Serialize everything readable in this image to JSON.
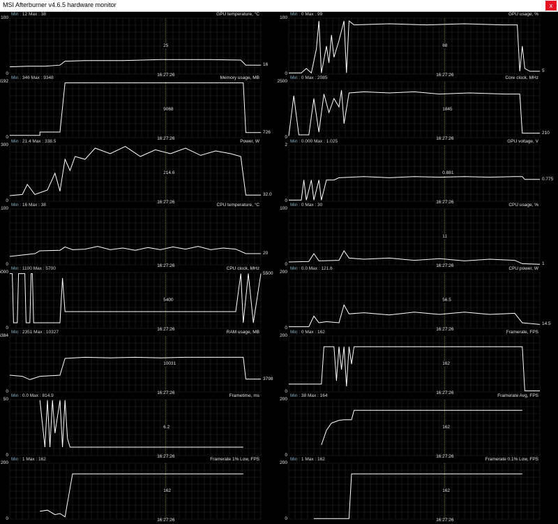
{
  "window": {
    "title": "MSI Afterburner v4.6.5 hardware monitor",
    "close_glyph": "x"
  },
  "colors": {
    "background": "#000000",
    "grid": "#2a2a2a",
    "line": "#ffffff",
    "marker": "#9a9a40",
    "min_label": "#8ab4c8"
  },
  "time_label": "16:27:26",
  "labels": {
    "min": "Min",
    "max": "Max"
  },
  "graphs": [
    {
      "id": "gpu-temp",
      "col": 0,
      "row": 0,
      "title": "GPU temperature, °C",
      "min": "12",
      "max": "38",
      "y_top": "100",
      "y_bottom": "0",
      "current": "16",
      "mid_value": "25",
      "trace": [
        [
          0,
          0.13
        ],
        [
          0.07,
          0.14
        ],
        [
          0.14,
          0.14
        ],
        [
          0.2,
          0.16
        ],
        [
          0.22,
          0.23
        ],
        [
          0.3,
          0.24
        ],
        [
          0.45,
          0.24
        ],
        [
          0.6,
          0.26
        ],
        [
          0.8,
          0.26
        ],
        [
          0.92,
          0.25
        ],
        [
          0.94,
          0.16
        ],
        [
          1,
          0.16
        ]
      ]
    },
    {
      "id": "gpu-usage",
      "col": 1,
      "row": 0,
      "title": "GPU usage, %",
      "min": "0",
      "max": "99",
      "y_top": "100",
      "y_bottom": "0",
      "current": "5",
      "mid_value": "88",
      "trace": [
        [
          0,
          0.02
        ],
        [
          0.05,
          0.02
        ],
        [
          0.07,
          0.1
        ],
        [
          0.09,
          0.02
        ],
        [
          0.11,
          0.45
        ],
        [
          0.12,
          0.95
        ],
        [
          0.13,
          0.02
        ],
        [
          0.15,
          0.5
        ],
        [
          0.16,
          0.2
        ],
        [
          0.17,
          0.7
        ],
        [
          0.18,
          0.3
        ],
        [
          0.2,
          0.6
        ],
        [
          0.22,
          0.95
        ],
        [
          0.23,
          0.02
        ],
        [
          0.24,
          0.95
        ],
        [
          0.26,
          0.88
        ],
        [
          0.4,
          0.9
        ],
        [
          0.55,
          0.88
        ],
        [
          0.7,
          0.9
        ],
        [
          0.85,
          0.88
        ],
        [
          0.91,
          0.88
        ],
        [
          0.92,
          0.05
        ],
        [
          0.93,
          0.5
        ],
        [
          0.94,
          0.1
        ],
        [
          0.96,
          0.05
        ],
        [
          1,
          0.05
        ]
      ]
    },
    {
      "id": "mem-usage",
      "col": 0,
      "row": 1,
      "title": "Memory usage, MB",
      "min": "346",
      "max": "9348",
      "y_top": "8192",
      "y_bottom": "0",
      "current": "726",
      "mid_value": "9068",
      "trace": [
        [
          0,
          0.04
        ],
        [
          0.12,
          0.04
        ],
        [
          0.12,
          0.1
        ],
        [
          0.2,
          0.1
        ],
        [
          0.22,
          0.98
        ],
        [
          0.93,
          0.98
        ],
        [
          0.94,
          0.09
        ],
        [
          1,
          0.09
        ]
      ]
    },
    {
      "id": "core-clock",
      "col": 1,
      "row": 1,
      "title": "Core clock, MHz",
      "min": "0",
      "max": "2085",
      "y_top": "2500",
      "y_bottom": "0",
      "current": "210",
      "mid_value": "1845",
      "trace": [
        [
          0,
          0.03
        ],
        [
          0.02,
          0.75
        ],
        [
          0.04,
          0.05
        ],
        [
          0.08,
          0.05
        ],
        [
          0.1,
          0.7
        ],
        [
          0.12,
          0.1
        ],
        [
          0.14,
          0.78
        ],
        [
          0.16,
          0.45
        ],
        [
          0.18,
          0.7
        ],
        [
          0.2,
          0.55
        ],
        [
          0.21,
          0.85
        ],
        [
          0.22,
          0.25
        ],
        [
          0.24,
          0.8
        ],
        [
          0.3,
          0.82
        ],
        [
          0.4,
          0.8
        ],
        [
          0.5,
          0.82
        ],
        [
          0.6,
          0.78
        ],
        [
          0.72,
          0.8
        ],
        [
          0.86,
          0.78
        ],
        [
          0.92,
          0.78
        ],
        [
          0.93,
          0.08
        ],
        [
          1,
          0.08
        ]
      ]
    },
    {
      "id": "power",
      "col": 0,
      "row": 2,
      "title": "Power, W",
      "min": "21.4",
      "max": "338.5",
      "y_top": "300",
      "y_bottom": "0",
      "current": "32.0",
      "mid_value": "214.6",
      "trace": [
        [
          0,
          0.1
        ],
        [
          0.05,
          0.12
        ],
        [
          0.07,
          0.3
        ],
        [
          0.1,
          0.12
        ],
        [
          0.15,
          0.2
        ],
        [
          0.18,
          0.5
        ],
        [
          0.2,
          0.18
        ],
        [
          0.22,
          0.75
        ],
        [
          0.24,
          0.55
        ],
        [
          0.26,
          0.8
        ],
        [
          0.3,
          0.75
        ],
        [
          0.34,
          0.95
        ],
        [
          0.4,
          0.85
        ],
        [
          0.46,
          0.98
        ],
        [
          0.52,
          0.8
        ],
        [
          0.58,
          0.92
        ],
        [
          0.64,
          0.85
        ],
        [
          0.7,
          0.95
        ],
        [
          0.76,
          0.82
        ],
        [
          0.82,
          0.9
        ],
        [
          0.88,
          0.85
        ],
        [
          0.92,
          0.8
        ],
        [
          0.94,
          0.11
        ],
        [
          1,
          0.11
        ]
      ]
    },
    {
      "id": "gpu-voltage",
      "col": 1,
      "row": 2,
      "title": "GPU voltage, V",
      "min": "0.000",
      "max": "1.025",
      "y_top": "2",
      "y_bottom": "0",
      "current": "0.775",
      "mid_value": "0.881",
      "trace": [
        [
          0,
          0.02
        ],
        [
          0.05,
          0.02
        ],
        [
          0.06,
          0.38
        ],
        [
          0.07,
          0.02
        ],
        [
          0.09,
          0.38
        ],
        [
          0.1,
          0.02
        ],
        [
          0.12,
          0.38
        ],
        [
          0.13,
          0.02
        ],
        [
          0.15,
          0.38
        ],
        [
          0.18,
          0.38
        ],
        [
          0.2,
          0.42
        ],
        [
          0.3,
          0.44
        ],
        [
          0.4,
          0.42
        ],
        [
          0.5,
          0.44
        ],
        [
          0.6,
          0.43
        ],
        [
          0.7,
          0.44
        ],
        [
          0.8,
          0.43
        ],
        [
          0.9,
          0.44
        ],
        [
          0.93,
          0.44
        ],
        [
          0.94,
          0.39
        ],
        [
          1,
          0.39
        ]
      ]
    },
    {
      "id": "cpu-temp",
      "col": 0,
      "row": 3,
      "title": "CPU temperature, °C",
      "min": "16",
      "max": "38",
      "y_top": "100",
      "y_bottom": "0",
      "current": "20",
      "mid_value": "",
      "trace": [
        [
          0,
          0.15
        ],
        [
          0.1,
          0.2
        ],
        [
          0.12,
          0.25
        ],
        [
          0.2,
          0.26
        ],
        [
          0.22,
          0.32
        ],
        [
          0.25,
          0.27
        ],
        [
          0.3,
          0.28
        ],
        [
          0.35,
          0.33
        ],
        [
          0.4,
          0.27
        ],
        [
          0.45,
          0.3
        ],
        [
          0.5,
          0.26
        ],
        [
          0.55,
          0.31
        ],
        [
          0.6,
          0.27
        ],
        [
          0.65,
          0.32
        ],
        [
          0.7,
          0.28
        ],
        [
          0.75,
          0.33
        ],
        [
          0.8,
          0.27
        ],
        [
          0.85,
          0.3
        ],
        [
          0.9,
          0.28
        ],
        [
          0.94,
          0.2
        ],
        [
          1,
          0.2
        ]
      ]
    },
    {
      "id": "cpu-usage",
      "col": 1,
      "row": 3,
      "title": "CPU usage, %",
      "min": "0",
      "max": "30",
      "y_top": "100",
      "y_bottom": "0",
      "current": "1",
      "mid_value": "11",
      "trace": [
        [
          0,
          0.05
        ],
        [
          0.08,
          0.06
        ],
        [
          0.1,
          0.2
        ],
        [
          0.12,
          0.07
        ],
        [
          0.2,
          0.08
        ],
        [
          0.22,
          0.25
        ],
        [
          0.24,
          0.12
        ],
        [
          0.3,
          0.1
        ],
        [
          0.4,
          0.12
        ],
        [
          0.5,
          0.08
        ],
        [
          0.6,
          0.11
        ],
        [
          0.7,
          0.07
        ],
        [
          0.8,
          0.1
        ],
        [
          0.9,
          0.08
        ],
        [
          0.93,
          0.02
        ],
        [
          1,
          0.01
        ]
      ]
    },
    {
      "id": "cpu-clock",
      "col": 0,
      "row": 4,
      "title": "CPU clock, MHz",
      "min": "1100",
      "max": "5700",
      "y_top": "5000",
      "y_bottom": "0",
      "current": "5500",
      "mid_value": "5400",
      "trace": [
        [
          0,
          0.98
        ],
        [
          0.01,
          0.98
        ],
        [
          0.015,
          0.1
        ],
        [
          0.03,
          0.1
        ],
        [
          0.035,
          0.98
        ],
        [
          0.06,
          0.98
        ],
        [
          0.065,
          0.1
        ],
        [
          0.08,
          0.1
        ],
        [
          0.085,
          0.98
        ],
        [
          0.09,
          0.98
        ],
        [
          0.095,
          0.1
        ],
        [
          0.2,
          0.1
        ],
        [
          0.21,
          0.9
        ],
        [
          0.22,
          0.3
        ],
        [
          0.24,
          0.3
        ],
        [
          0.9,
          0.3
        ],
        [
          0.92,
          0.98
        ],
        [
          0.93,
          0.1
        ],
        [
          0.95,
          0.98
        ],
        [
          0.97,
          0.1
        ],
        [
          1,
          0.98
        ]
      ]
    },
    {
      "id": "cpu-power",
      "col": 1,
      "row": 4,
      "title": "CPU power, W",
      "min": "0.0",
      "max": "121.6",
      "y_top": "200",
      "y_bottom": "0",
      "current": "14.5",
      "mid_value": "56.5",
      "trace": [
        [
          0,
          0.03
        ],
        [
          0.08,
          0.03
        ],
        [
          0.1,
          0.22
        ],
        [
          0.12,
          0.1
        ],
        [
          0.15,
          0.12
        ],
        [
          0.2,
          0.1
        ],
        [
          0.22,
          0.42
        ],
        [
          0.24,
          0.26
        ],
        [
          0.3,
          0.28
        ],
        [
          0.4,
          0.24
        ],
        [
          0.5,
          0.29
        ],
        [
          0.6,
          0.25
        ],
        [
          0.7,
          0.29
        ],
        [
          0.8,
          0.25
        ],
        [
          0.9,
          0.27
        ],
        [
          0.93,
          0.1
        ],
        [
          1,
          0.07
        ]
      ]
    },
    {
      "id": "ram-usage",
      "col": 0,
      "row": 5,
      "title": "RAM usage, MB",
      "min": "2351",
      "max": "10327",
      "y_top": "16384",
      "y_bottom": "0",
      "current": "3798",
      "mid_value": "10031",
      "trace": [
        [
          0,
          0.3
        ],
        [
          0.05,
          0.28
        ],
        [
          0.08,
          0.22
        ],
        [
          0.12,
          0.28
        ],
        [
          0.2,
          0.3
        ],
        [
          0.22,
          0.6
        ],
        [
          0.3,
          0.62
        ],
        [
          0.4,
          0.61
        ],
        [
          0.5,
          0.62
        ],
        [
          0.6,
          0.61
        ],
        [
          0.7,
          0.62
        ],
        [
          0.8,
          0.62
        ],
        [
          0.93,
          0.62
        ],
        [
          0.94,
          0.23
        ],
        [
          1,
          0.23
        ]
      ]
    },
    {
      "id": "framerate",
      "col": 1,
      "row": 5,
      "title": "Framerate, FPS",
      "min": "0",
      "max": "162",
      "y_top": "200",
      "y_bottom": "0",
      "current": "",
      "mid_value": "162",
      "trace": [
        [
          0,
          0.14
        ],
        [
          0.13,
          0.14
        ],
        [
          0.14,
          0.81
        ],
        [
          0.18,
          0.81
        ],
        [
          0.19,
          0.2
        ],
        [
          0.2,
          0.81
        ],
        [
          0.21,
          0.4
        ],
        [
          0.22,
          0.81
        ],
        [
          0.23,
          0.1
        ],
        [
          0.24,
          0.81
        ],
        [
          0.25,
          0.5
        ],
        [
          0.26,
          0.81
        ],
        [
          0.93,
          0.81
        ],
        [
          0.94,
          0.02
        ],
        [
          1,
          0.02
        ]
      ]
    },
    {
      "id": "frametime",
      "col": 0,
      "row": 6,
      "title": "Frametime, ms",
      "min": "0.0",
      "max": "814.9",
      "y_top": "50",
      "y_bottom": "0",
      "current": "",
      "mid_value": "6.2",
      "trace": [
        [
          0.12,
          0.99
        ],
        [
          0.14,
          0.15
        ],
        [
          0.15,
          0.99
        ],
        [
          0.16,
          0.15
        ],
        [
          0.17,
          0.99
        ],
        [
          0.18,
          0.4
        ],
        [
          0.2,
          0.99
        ],
        [
          0.21,
          0.15
        ],
        [
          0.22,
          0.99
        ],
        [
          0.23,
          0.3
        ],
        [
          0.24,
          0.15
        ],
        [
          0.93,
          0.15
        ]
      ]
    },
    {
      "id": "framerate-avg",
      "col": 1,
      "row": 6,
      "title": "Framerate Avg, FPS",
      "min": "38",
      "max": "164",
      "y_top": "200",
      "y_bottom": "0",
      "current": "",
      "mid_value": "162",
      "trace": [
        [
          0.13,
          0.19
        ],
        [
          0.15,
          0.45
        ],
        [
          0.17,
          0.58
        ],
        [
          0.2,
          0.63
        ],
        [
          0.22,
          0.64
        ],
        [
          0.25,
          0.64
        ],
        [
          0.26,
          0.81
        ],
        [
          0.93,
          0.81
        ]
      ]
    },
    {
      "id": "framerate-1pct",
      "col": 0,
      "row": 7,
      "title": "Framerate 1% Low, FPS",
      "min": "1",
      "max": "162",
      "y_top": "200",
      "y_bottom": "0",
      "current": "",
      "mid_value": "162",
      "trace": [
        [
          0.12,
          0.14
        ],
        [
          0.15,
          0.16
        ],
        [
          0.18,
          0.08
        ],
        [
          0.2,
          0.1
        ],
        [
          0.22,
          0.04
        ],
        [
          0.25,
          0.81
        ],
        [
          0.93,
          0.81
        ]
      ]
    },
    {
      "id": "framerate-01pct",
      "col": 1,
      "row": 7,
      "title": "Framerate 0.1% Low, FPS",
      "min": "1",
      "max": "162",
      "y_top": "200",
      "y_bottom": "0",
      "current": "",
      "mid_value": "162",
      "trace": [
        [
          0.1,
          0.01
        ],
        [
          0.24,
          0.01
        ],
        [
          0.25,
          0.81
        ],
        [
          0.93,
          0.81
        ]
      ]
    }
  ]
}
